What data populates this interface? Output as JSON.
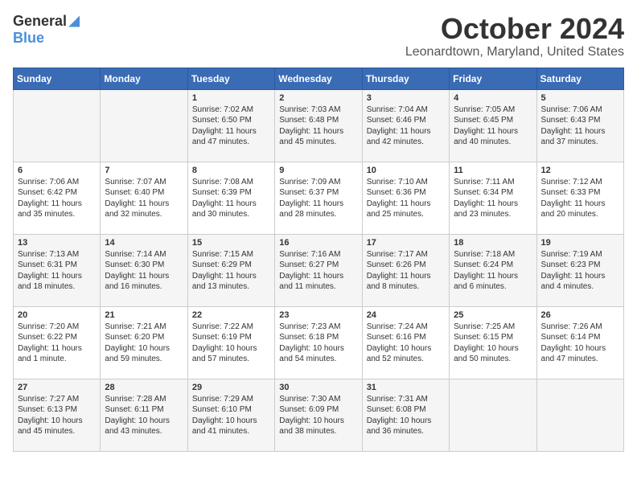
{
  "header": {
    "logo_general": "General",
    "logo_blue": "Blue",
    "title": "October 2024",
    "subtitle": "Leonardtown, Maryland, United States"
  },
  "days_of_week": [
    "Sunday",
    "Monday",
    "Tuesday",
    "Wednesday",
    "Thursday",
    "Friday",
    "Saturday"
  ],
  "weeks": [
    [
      {
        "day": "",
        "info": ""
      },
      {
        "day": "",
        "info": ""
      },
      {
        "day": "1",
        "info": "Sunrise: 7:02 AM\nSunset: 6:50 PM\nDaylight: 11 hours and 47 minutes."
      },
      {
        "day": "2",
        "info": "Sunrise: 7:03 AM\nSunset: 6:48 PM\nDaylight: 11 hours and 45 minutes."
      },
      {
        "day": "3",
        "info": "Sunrise: 7:04 AM\nSunset: 6:46 PM\nDaylight: 11 hours and 42 minutes."
      },
      {
        "day": "4",
        "info": "Sunrise: 7:05 AM\nSunset: 6:45 PM\nDaylight: 11 hours and 40 minutes."
      },
      {
        "day": "5",
        "info": "Sunrise: 7:06 AM\nSunset: 6:43 PM\nDaylight: 11 hours and 37 minutes."
      }
    ],
    [
      {
        "day": "6",
        "info": "Sunrise: 7:06 AM\nSunset: 6:42 PM\nDaylight: 11 hours and 35 minutes."
      },
      {
        "day": "7",
        "info": "Sunrise: 7:07 AM\nSunset: 6:40 PM\nDaylight: 11 hours and 32 minutes."
      },
      {
        "day": "8",
        "info": "Sunrise: 7:08 AM\nSunset: 6:39 PM\nDaylight: 11 hours and 30 minutes."
      },
      {
        "day": "9",
        "info": "Sunrise: 7:09 AM\nSunset: 6:37 PM\nDaylight: 11 hours and 28 minutes."
      },
      {
        "day": "10",
        "info": "Sunrise: 7:10 AM\nSunset: 6:36 PM\nDaylight: 11 hours and 25 minutes."
      },
      {
        "day": "11",
        "info": "Sunrise: 7:11 AM\nSunset: 6:34 PM\nDaylight: 11 hours and 23 minutes."
      },
      {
        "day": "12",
        "info": "Sunrise: 7:12 AM\nSunset: 6:33 PM\nDaylight: 11 hours and 20 minutes."
      }
    ],
    [
      {
        "day": "13",
        "info": "Sunrise: 7:13 AM\nSunset: 6:31 PM\nDaylight: 11 hours and 18 minutes."
      },
      {
        "day": "14",
        "info": "Sunrise: 7:14 AM\nSunset: 6:30 PM\nDaylight: 11 hours and 16 minutes."
      },
      {
        "day": "15",
        "info": "Sunrise: 7:15 AM\nSunset: 6:29 PM\nDaylight: 11 hours and 13 minutes."
      },
      {
        "day": "16",
        "info": "Sunrise: 7:16 AM\nSunset: 6:27 PM\nDaylight: 11 hours and 11 minutes."
      },
      {
        "day": "17",
        "info": "Sunrise: 7:17 AM\nSunset: 6:26 PM\nDaylight: 11 hours and 8 minutes."
      },
      {
        "day": "18",
        "info": "Sunrise: 7:18 AM\nSunset: 6:24 PM\nDaylight: 11 hours and 6 minutes."
      },
      {
        "day": "19",
        "info": "Sunrise: 7:19 AM\nSunset: 6:23 PM\nDaylight: 11 hours and 4 minutes."
      }
    ],
    [
      {
        "day": "20",
        "info": "Sunrise: 7:20 AM\nSunset: 6:22 PM\nDaylight: 11 hours and 1 minute."
      },
      {
        "day": "21",
        "info": "Sunrise: 7:21 AM\nSunset: 6:20 PM\nDaylight: 10 hours and 59 minutes."
      },
      {
        "day": "22",
        "info": "Sunrise: 7:22 AM\nSunset: 6:19 PM\nDaylight: 10 hours and 57 minutes."
      },
      {
        "day": "23",
        "info": "Sunrise: 7:23 AM\nSunset: 6:18 PM\nDaylight: 10 hours and 54 minutes."
      },
      {
        "day": "24",
        "info": "Sunrise: 7:24 AM\nSunset: 6:16 PM\nDaylight: 10 hours and 52 minutes."
      },
      {
        "day": "25",
        "info": "Sunrise: 7:25 AM\nSunset: 6:15 PM\nDaylight: 10 hours and 50 minutes."
      },
      {
        "day": "26",
        "info": "Sunrise: 7:26 AM\nSunset: 6:14 PM\nDaylight: 10 hours and 47 minutes."
      }
    ],
    [
      {
        "day": "27",
        "info": "Sunrise: 7:27 AM\nSunset: 6:13 PM\nDaylight: 10 hours and 45 minutes."
      },
      {
        "day": "28",
        "info": "Sunrise: 7:28 AM\nSunset: 6:11 PM\nDaylight: 10 hours and 43 minutes."
      },
      {
        "day": "29",
        "info": "Sunrise: 7:29 AM\nSunset: 6:10 PM\nDaylight: 10 hours and 41 minutes."
      },
      {
        "day": "30",
        "info": "Sunrise: 7:30 AM\nSunset: 6:09 PM\nDaylight: 10 hours and 38 minutes."
      },
      {
        "day": "31",
        "info": "Sunrise: 7:31 AM\nSunset: 6:08 PM\nDaylight: 10 hours and 36 minutes."
      },
      {
        "day": "",
        "info": ""
      },
      {
        "day": "",
        "info": ""
      }
    ]
  ]
}
